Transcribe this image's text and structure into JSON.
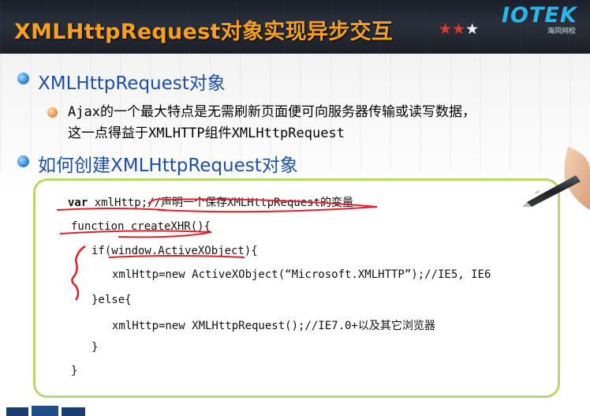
{
  "header": {
    "title": "XMLHttpRequest对象实现异步交互",
    "stars": [
      "★",
      "★",
      "★"
    ],
    "logo_text": "IOTEK",
    "logo_sub": "海同网校"
  },
  "bullets": [
    {
      "text": "XMLHttpRequest对象"
    },
    {
      "text": "如何创建XMLHttpRequest对象"
    }
  ],
  "sub_bullet": {
    "line1": "Ajax的一个最大特点是无需刷新页面便可向服务器传输或读写数据，",
    "line2": "这一点得益于XMLHTTP组件XMLHttpRequest"
  },
  "code": {
    "line1_kw": "var",
    "line1_rest": " xmlHttp;//声明一个保存XMLHttpRequest的变量",
    "line2": "function createXHR(){",
    "line3": "if(window.ActiveXObject){",
    "line4": "xmlHttp=new ActiveXObject(“Microsoft.XMLHTTP”);//IE5, IE6",
    "line5": "}else{",
    "line6": "xmlHttp=new XMLHttpRequest();//IE7.0+以及其它浏览器",
    "line7": "}",
    "line8": "}"
  },
  "colors": {
    "title": "#f7a020",
    "heading": "#1e4fa6",
    "ink": "#e0202a",
    "box_border": "#b6d96a"
  }
}
